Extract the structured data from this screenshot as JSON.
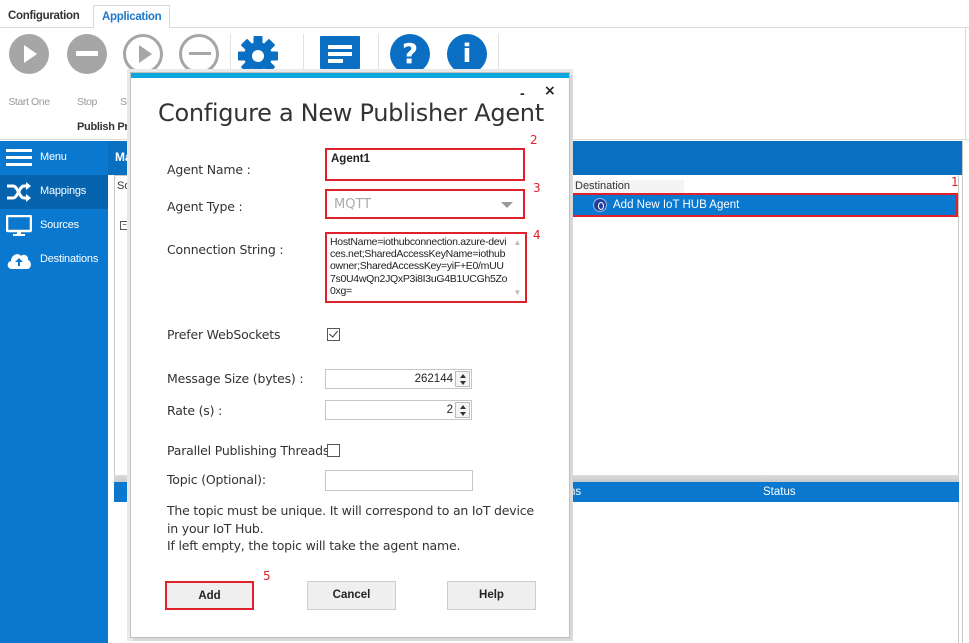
{
  "ribbon": {
    "tabs": [
      {
        "label": "Configuration",
        "active": false
      },
      {
        "label": "Application",
        "active": true
      }
    ],
    "buttons": [
      {
        "label": "Start One",
        "icon": "play-circle-icon"
      },
      {
        "label": "Stop",
        "icon": "stop-circle-icon"
      },
      {
        "label": "S",
        "icon": "play-circle-outline-icon"
      },
      {
        "label": "",
        "icon": "stop-circle-outline-icon"
      },
      {
        "label": "",
        "icon": "gear-icon"
      },
      {
        "label": "",
        "icon": "message-icon"
      },
      {
        "label": "",
        "icon": "help-icon"
      },
      {
        "label": "",
        "icon": "info-icon"
      }
    ],
    "group_label": "Publish Pro"
  },
  "sidebar": {
    "items": [
      {
        "label": "Menu",
        "icon": "hamburger-icon",
        "active": false
      },
      {
        "label": "Mappings",
        "icon": "shuffle-icon",
        "active": true
      },
      {
        "label": "Sources",
        "icon": "monitor-icon",
        "active": false
      },
      {
        "label": "Destinations",
        "icon": "cloud-upload-icon",
        "active": false
      }
    ]
  },
  "main": {
    "title": "Ma",
    "sources_header": "So",
    "tree_toggle": "−",
    "destination_header": "Destination",
    "destination_row": "Add New IoT HUB Agent",
    "bottom_columns": [
      "ns",
      "Status"
    ]
  },
  "annotations": [
    "1",
    "2",
    "3",
    "4",
    "5"
  ],
  "dialog": {
    "title": "Configure a New Publisher Agent",
    "minimize": "-",
    "close": "×",
    "fields": {
      "agent_name_label": "Agent Name :",
      "agent_name_value": "Agent1",
      "agent_type_label": "Agent Type :",
      "agent_type_value": "MQTT",
      "connection_string_label": "Connection String :",
      "connection_string_value": "HostName=iothubconnection.azure-devices.net;SharedAccessKeyName=iothubowner;SharedAccessKey=yiF+E0/mUU7s0U4wQn2JQxP3i8I3uG4B1UCGh5Zo0xg=",
      "prefer_websockets_label": "Prefer WebSockets",
      "prefer_websockets_checked": true,
      "message_size_label": "Message Size (bytes) :",
      "message_size_value": "262144",
      "rate_label": "Rate (s) :",
      "rate_value": "2",
      "parallel_label": "Parallel Publishing Threads",
      "parallel_checked": false,
      "topic_label": "Topic (Optional):",
      "topic_value": ""
    },
    "note_line1": "The topic must be unique. It will correspond to an IoT device in your IoT Hub.",
    "note_line2": "If left empty, the topic will take the agent name.",
    "buttons": {
      "add": "Add",
      "cancel": "Cancel",
      "help": "Help"
    }
  },
  "colors": {
    "accent_blue": "#0a78cf",
    "dialog_top_bar": "#0aa6dc",
    "annotation_red": "#e0202a"
  }
}
